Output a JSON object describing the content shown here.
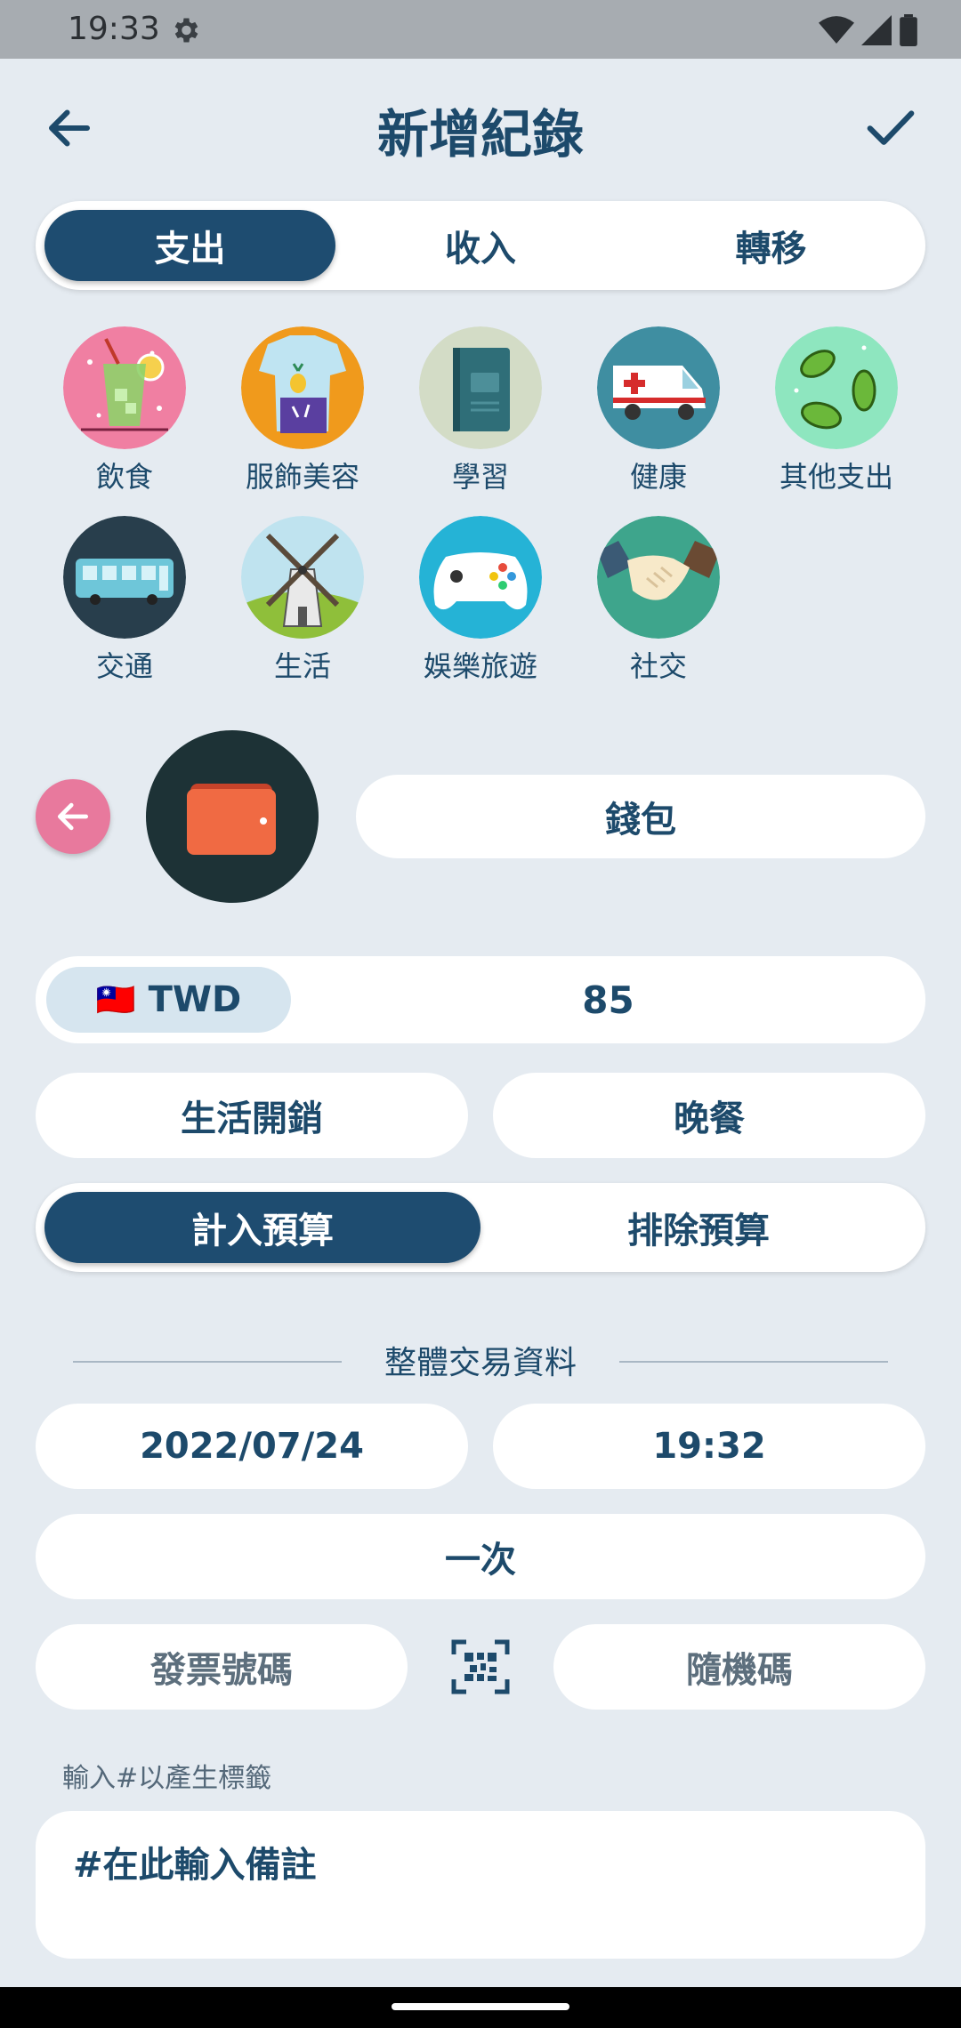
{
  "status": {
    "time": "19:33"
  },
  "header": {
    "title": "新增紀錄"
  },
  "type_tabs": [
    "支出",
    "收入",
    "轉移"
  ],
  "categories": [
    {
      "label": "飲食",
      "icon": "drink-icon"
    },
    {
      "label": "服飾美容",
      "icon": "clothing-icon"
    },
    {
      "label": "學習",
      "icon": "book-icon"
    },
    {
      "label": "健康",
      "icon": "ambulance-icon"
    },
    {
      "label": "其他支出",
      "icon": "leaves-icon"
    },
    {
      "label": "交通",
      "icon": "bus-icon"
    },
    {
      "label": "生活",
      "icon": "windmill-icon"
    },
    {
      "label": "娛樂旅遊",
      "icon": "gamepad-icon"
    },
    {
      "label": "社交",
      "icon": "handshake-icon"
    }
  ],
  "account": {
    "name": "錢包",
    "icon": "wallet-icon"
  },
  "amount": {
    "currency_flag": "🇹🇼",
    "currency": "TWD",
    "value": "85"
  },
  "subcategory": {
    "left": "生活開銷",
    "right": "晚餐"
  },
  "budget_tabs": [
    "計入預算",
    "排除預算"
  ],
  "section": {
    "title": "整體交易資料"
  },
  "datetime": {
    "date": "2022/07/24",
    "time": "19:32"
  },
  "repeat": "一次",
  "invoice": {
    "number": "發票號碼",
    "random": "隨機碼"
  },
  "note": {
    "hint": "輸入#以產生標籤",
    "placeholder": "#在此輸入備註"
  },
  "colors": {
    "primary": "#1e4c70",
    "background": "#e5ebf1",
    "accent_pink": "#e8799d"
  }
}
